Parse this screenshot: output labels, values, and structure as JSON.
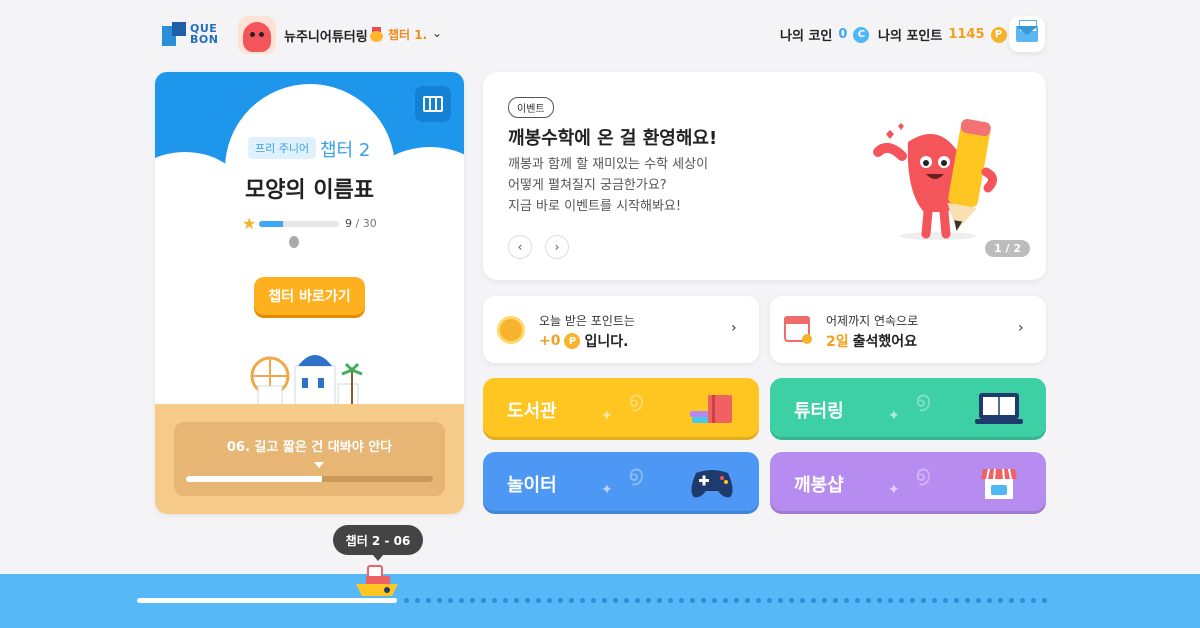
{
  "header": {
    "logo_line1": "QUE",
    "logo_line2": "BON",
    "username": "뉴주니어튜터링",
    "chapter_badge": "챕터 1.",
    "coin_label": "나의 코인",
    "coin_value": "0",
    "coin_icon": "C",
    "point_label": "나의 포인트",
    "point_value": "1145",
    "point_icon": "P"
  },
  "chapter": {
    "badge": "프리 주니어",
    "label": "챕터 2",
    "title": "모양의 이름표",
    "progress_done": "9",
    "progress_total": "/ 30",
    "progress_fraction": 0.3,
    "button": "챕터 바로가기",
    "lesson_title": "06. 길고 짧은 건 대봐야 안다",
    "lesson_fraction": 0.55
  },
  "event": {
    "tag": "이벤트",
    "title": "깨봉수학에 온 걸 환영해요!",
    "desc_lines": [
      "깨봉과 함께 할 재미있는 수학 세상이",
      "어떻게 펼쳐질지 궁금한가요?",
      "지금 바로 이벤트를 시작해봐요!"
    ],
    "prev": "‹",
    "next": "›",
    "page": "1 / 2"
  },
  "info": {
    "points_l1": "오늘 받은 포인트는",
    "points_value": "+0",
    "points_icon": "P",
    "points_suffix": "입니다.",
    "attend_l1": "어제까지 연속으로",
    "attend_value": "2일",
    "attend_suffix": "출석했어요",
    "chevron": "›"
  },
  "tiles": {
    "library": "도서관",
    "tutoring": "튜터링",
    "play": "놀이터",
    "shop": "깨봉샵"
  },
  "colors": {
    "library": "#ffc622",
    "tutoring": "#3dd0a4",
    "play": "#4e98f5",
    "shop": "#b78cf0"
  },
  "track": {
    "tooltip": "챕터 2 - 06",
    "progress_fraction": 0.28
  }
}
